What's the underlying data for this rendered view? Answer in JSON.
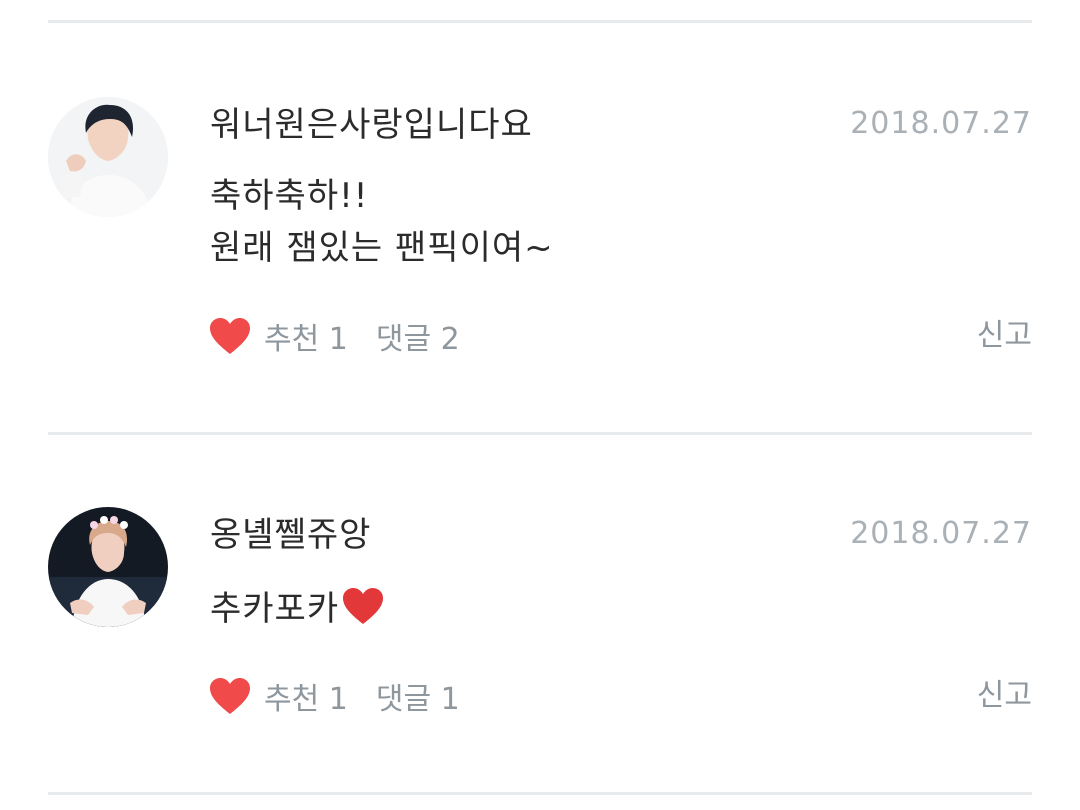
{
  "comments": [
    {
      "author": "워너원은사랑입니다요",
      "date": "2018.07.27",
      "body_lines": [
        "축하축하!!",
        "원래 잼있는 팬픽이여~"
      ],
      "recommend_label": "추천",
      "recommend_count": "1",
      "reply_label": "댓글",
      "reply_count": "2",
      "report_label": "신고"
    },
    {
      "author": "옹녤쩰쥬앙",
      "date": "2018.07.27",
      "body_lines": [
        "추카포카"
      ],
      "recommend_label": "추천",
      "recommend_count": "1",
      "reply_label": "댓글",
      "reply_count": "1",
      "report_label": "신고"
    }
  ],
  "icons": {
    "like": "heart-icon",
    "inline_emoji": "red-heart-emoji"
  },
  "colors": {
    "heart": "#f04a4a",
    "divider": "#e7ebee",
    "muted_text": "#8f979e",
    "date_text": "#a9b0b6"
  }
}
